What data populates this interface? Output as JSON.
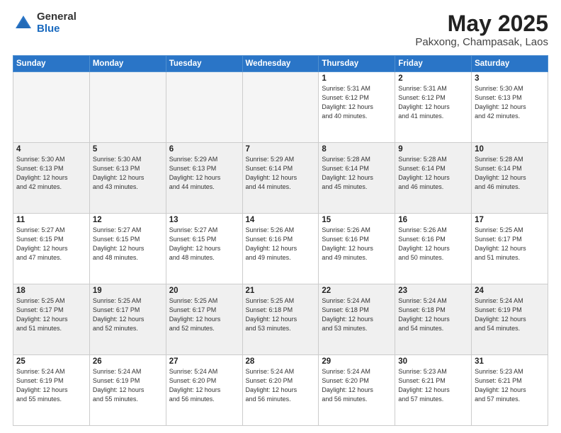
{
  "header": {
    "logo_general": "General",
    "logo_blue": "Blue",
    "title": "May 2025",
    "location": "Pakxong, Champasak, Laos"
  },
  "days_of_week": [
    "Sunday",
    "Monday",
    "Tuesday",
    "Wednesday",
    "Thursday",
    "Friday",
    "Saturday"
  ],
  "weeks": [
    [
      {
        "day": "",
        "info": ""
      },
      {
        "day": "",
        "info": ""
      },
      {
        "day": "",
        "info": ""
      },
      {
        "day": "",
        "info": ""
      },
      {
        "day": "1",
        "info": "Sunrise: 5:31 AM\nSunset: 6:12 PM\nDaylight: 12 hours\nand 40 minutes."
      },
      {
        "day": "2",
        "info": "Sunrise: 5:31 AM\nSunset: 6:12 PM\nDaylight: 12 hours\nand 41 minutes."
      },
      {
        "day": "3",
        "info": "Sunrise: 5:30 AM\nSunset: 6:13 PM\nDaylight: 12 hours\nand 42 minutes."
      }
    ],
    [
      {
        "day": "4",
        "info": "Sunrise: 5:30 AM\nSunset: 6:13 PM\nDaylight: 12 hours\nand 42 minutes."
      },
      {
        "day": "5",
        "info": "Sunrise: 5:30 AM\nSunset: 6:13 PM\nDaylight: 12 hours\nand 43 minutes."
      },
      {
        "day": "6",
        "info": "Sunrise: 5:29 AM\nSunset: 6:13 PM\nDaylight: 12 hours\nand 44 minutes."
      },
      {
        "day": "7",
        "info": "Sunrise: 5:29 AM\nSunset: 6:14 PM\nDaylight: 12 hours\nand 44 minutes."
      },
      {
        "day": "8",
        "info": "Sunrise: 5:28 AM\nSunset: 6:14 PM\nDaylight: 12 hours\nand 45 minutes."
      },
      {
        "day": "9",
        "info": "Sunrise: 5:28 AM\nSunset: 6:14 PM\nDaylight: 12 hours\nand 46 minutes."
      },
      {
        "day": "10",
        "info": "Sunrise: 5:28 AM\nSunset: 6:14 PM\nDaylight: 12 hours\nand 46 minutes."
      }
    ],
    [
      {
        "day": "11",
        "info": "Sunrise: 5:27 AM\nSunset: 6:15 PM\nDaylight: 12 hours\nand 47 minutes."
      },
      {
        "day": "12",
        "info": "Sunrise: 5:27 AM\nSunset: 6:15 PM\nDaylight: 12 hours\nand 48 minutes."
      },
      {
        "day": "13",
        "info": "Sunrise: 5:27 AM\nSunset: 6:15 PM\nDaylight: 12 hours\nand 48 minutes."
      },
      {
        "day": "14",
        "info": "Sunrise: 5:26 AM\nSunset: 6:16 PM\nDaylight: 12 hours\nand 49 minutes."
      },
      {
        "day": "15",
        "info": "Sunrise: 5:26 AM\nSunset: 6:16 PM\nDaylight: 12 hours\nand 49 minutes."
      },
      {
        "day": "16",
        "info": "Sunrise: 5:26 AM\nSunset: 6:16 PM\nDaylight: 12 hours\nand 50 minutes."
      },
      {
        "day": "17",
        "info": "Sunrise: 5:25 AM\nSunset: 6:17 PM\nDaylight: 12 hours\nand 51 minutes."
      }
    ],
    [
      {
        "day": "18",
        "info": "Sunrise: 5:25 AM\nSunset: 6:17 PM\nDaylight: 12 hours\nand 51 minutes."
      },
      {
        "day": "19",
        "info": "Sunrise: 5:25 AM\nSunset: 6:17 PM\nDaylight: 12 hours\nand 52 minutes."
      },
      {
        "day": "20",
        "info": "Sunrise: 5:25 AM\nSunset: 6:17 PM\nDaylight: 12 hours\nand 52 minutes."
      },
      {
        "day": "21",
        "info": "Sunrise: 5:25 AM\nSunset: 6:18 PM\nDaylight: 12 hours\nand 53 minutes."
      },
      {
        "day": "22",
        "info": "Sunrise: 5:24 AM\nSunset: 6:18 PM\nDaylight: 12 hours\nand 53 minutes."
      },
      {
        "day": "23",
        "info": "Sunrise: 5:24 AM\nSunset: 6:18 PM\nDaylight: 12 hours\nand 54 minutes."
      },
      {
        "day": "24",
        "info": "Sunrise: 5:24 AM\nSunset: 6:19 PM\nDaylight: 12 hours\nand 54 minutes."
      }
    ],
    [
      {
        "day": "25",
        "info": "Sunrise: 5:24 AM\nSunset: 6:19 PM\nDaylight: 12 hours\nand 55 minutes."
      },
      {
        "day": "26",
        "info": "Sunrise: 5:24 AM\nSunset: 6:19 PM\nDaylight: 12 hours\nand 55 minutes."
      },
      {
        "day": "27",
        "info": "Sunrise: 5:24 AM\nSunset: 6:20 PM\nDaylight: 12 hours\nand 56 minutes."
      },
      {
        "day": "28",
        "info": "Sunrise: 5:24 AM\nSunset: 6:20 PM\nDaylight: 12 hours\nand 56 minutes."
      },
      {
        "day": "29",
        "info": "Sunrise: 5:24 AM\nSunset: 6:20 PM\nDaylight: 12 hours\nand 56 minutes."
      },
      {
        "day": "30",
        "info": "Sunrise: 5:23 AM\nSunset: 6:21 PM\nDaylight: 12 hours\nand 57 minutes."
      },
      {
        "day": "31",
        "info": "Sunrise: 5:23 AM\nSunset: 6:21 PM\nDaylight: 12 hours\nand 57 minutes."
      }
    ]
  ]
}
